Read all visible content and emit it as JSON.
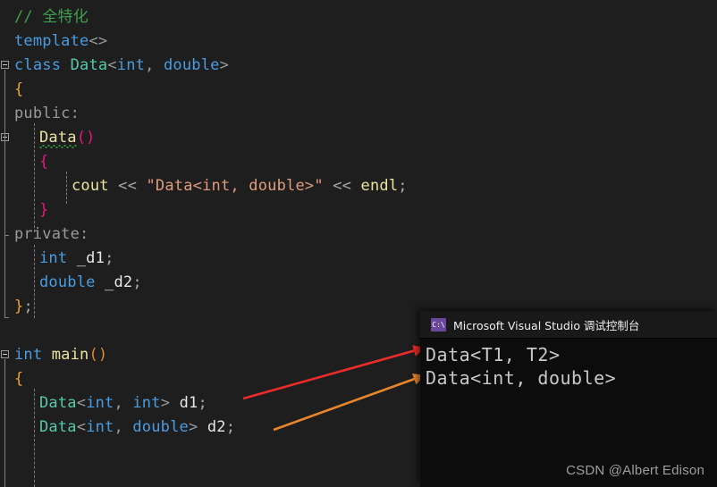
{
  "editor": {
    "background": "#1e1e1e",
    "lines": [
      {
        "indent": 0,
        "tokens": [
          {
            "text": "// ",
            "cls": "t-comment"
          },
          {
            "text": "全特化",
            "cls": "t-comment cjk"
          }
        ]
      },
      {
        "indent": 0,
        "tokens": [
          {
            "text": "template",
            "cls": "t-kw"
          },
          {
            "text": "<>",
            "cls": "t-punc"
          }
        ]
      },
      {
        "indent": 0,
        "tokens": [
          {
            "text": "class ",
            "cls": "t-kw"
          },
          {
            "text": "Data",
            "cls": "t-type"
          },
          {
            "text": "<",
            "cls": "t-punc"
          },
          {
            "text": "int",
            "cls": "t-kw"
          },
          {
            "text": ", ",
            "cls": "t-punc"
          },
          {
            "text": "double",
            "cls": "t-kw"
          },
          {
            "text": ">",
            "cls": "t-punc"
          }
        ]
      },
      {
        "indent": 0,
        "tokens": [
          {
            "text": "{",
            "cls": "t-brace-o"
          }
        ]
      },
      {
        "indent": 0,
        "tokens": [
          {
            "text": "public:",
            "cls": "t-access"
          }
        ]
      },
      {
        "indent": 1,
        "tokens": [
          {
            "text": "Data",
            "cls": "t-func squiggle"
          },
          {
            "text": "()",
            "cls": "t-magenta"
          }
        ]
      },
      {
        "indent": 1,
        "tokens": [
          {
            "text": "{",
            "cls": "t-magenta"
          }
        ]
      },
      {
        "indent": 2,
        "tokens": [
          {
            "text": "cout",
            "cls": "t-func"
          },
          {
            "text": " << ",
            "cls": "t-op"
          },
          {
            "text": "\"Data<int, double>\"",
            "cls": "t-string"
          },
          {
            "text": " << ",
            "cls": "t-op"
          },
          {
            "text": "endl",
            "cls": "t-func"
          },
          {
            "text": ";",
            "cls": "t-op"
          }
        ]
      },
      {
        "indent": 1,
        "tokens": [
          {
            "text": "}",
            "cls": "t-magenta"
          }
        ]
      },
      {
        "indent": 0,
        "tokens": [
          {
            "text": "private:",
            "cls": "t-access"
          }
        ]
      },
      {
        "indent": 1,
        "tokens": [
          {
            "text": "int",
            "cls": "t-kw"
          },
          {
            "text": " _d1",
            "cls": "t-ident"
          },
          {
            "text": ";",
            "cls": "t-op"
          }
        ]
      },
      {
        "indent": 1,
        "tokens": [
          {
            "text": "double",
            "cls": "t-kw"
          },
          {
            "text": " _d2",
            "cls": "t-ident"
          },
          {
            "text": ";",
            "cls": "t-op"
          }
        ]
      },
      {
        "indent": 0,
        "tokens": [
          {
            "text": "}",
            "cls": "t-brace-o"
          },
          {
            "text": ";",
            "cls": "t-op"
          }
        ]
      },
      {
        "indent": 0,
        "tokens": []
      },
      {
        "indent": 0,
        "tokens": [
          {
            "text": "int",
            "cls": "t-kw"
          },
          {
            "text": " ",
            "cls": "t-op"
          },
          {
            "text": "main",
            "cls": "t-func"
          },
          {
            "text": "()",
            "cls": "t-orange"
          }
        ]
      },
      {
        "indent": 0,
        "tokens": [
          {
            "text": "{",
            "cls": "t-brace-o"
          }
        ]
      },
      {
        "indent": 1,
        "tokens": [
          {
            "text": "Data",
            "cls": "t-type"
          },
          {
            "text": "<",
            "cls": "t-punc"
          },
          {
            "text": "int",
            "cls": "t-kw"
          },
          {
            "text": ", ",
            "cls": "t-punc"
          },
          {
            "text": "int",
            "cls": "t-kw"
          },
          {
            "text": "> ",
            "cls": "t-punc"
          },
          {
            "text": "d1",
            "cls": "t-ident"
          },
          {
            "text": ";",
            "cls": "t-op"
          }
        ]
      },
      {
        "indent": 1,
        "tokens": [
          {
            "text": "Data",
            "cls": "t-type"
          },
          {
            "text": "<",
            "cls": "t-punc"
          },
          {
            "text": "int",
            "cls": "t-kw"
          },
          {
            "text": ", ",
            "cls": "t-punc"
          },
          {
            "text": "double",
            "cls": "t-kw"
          },
          {
            "text": "> ",
            "cls": "t-punc"
          },
          {
            "text": "d2",
            "cls": "t-ident"
          },
          {
            "text": ";",
            "cls": "t-op"
          }
        ]
      }
    ]
  },
  "console": {
    "title": "Microsoft Visual Studio 调试控制台",
    "icon_label": "C:\\",
    "icon_color": "#68479c",
    "output": [
      "Data<T1, T2>",
      "Data<int, double>"
    ]
  },
  "annotations": {
    "arrow_red_color": "#ee2b2b",
    "arrow_orange_color": "#e8872a"
  },
  "watermark": {
    "text": "CSDN @Albert Edison"
  }
}
